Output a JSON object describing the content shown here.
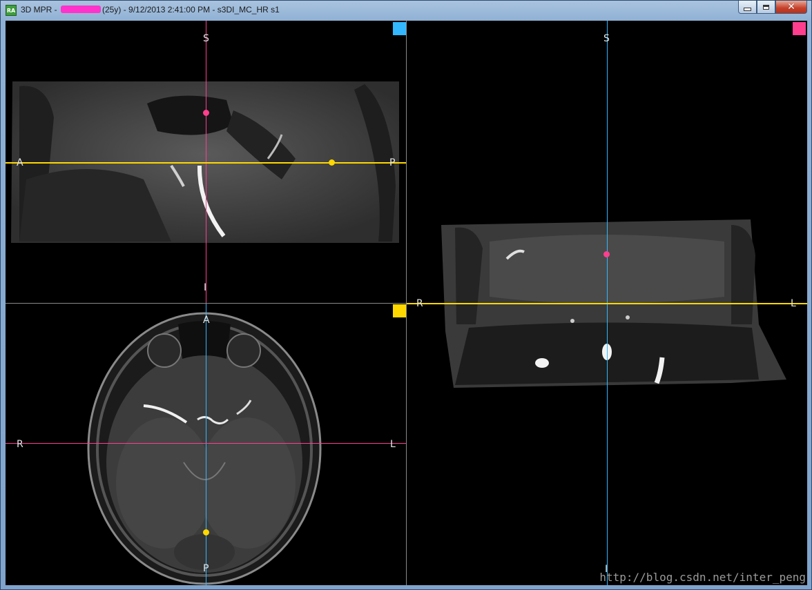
{
  "window": {
    "title_prefix": "3D MPR - ",
    "title_suffix": "(25y) - 9/12/2013 2:41:00 PM - s3DI_MC_HR s1",
    "app_icon_text": "RA",
    "buttons": {
      "minimize": "minimize-icon",
      "maximize": "maximize-icon",
      "close": "✕"
    }
  },
  "colors": {
    "sagittal": "#33b8ff",
    "coronal": "#ff3f8e",
    "axial": "#ffd800",
    "divider": "#8a8a8a"
  },
  "views": {
    "sagittal": {
      "top": "S",
      "bottom": "I",
      "left": "A",
      "right": "P"
    },
    "axial": {
      "top": "A",
      "bottom": "P",
      "left": "R",
      "right": "L"
    },
    "coronal": {
      "top": "S",
      "bottom": "I",
      "left": "R",
      "right": "L"
    }
  },
  "watermark": "http://blog.csdn.net/inter_peng"
}
